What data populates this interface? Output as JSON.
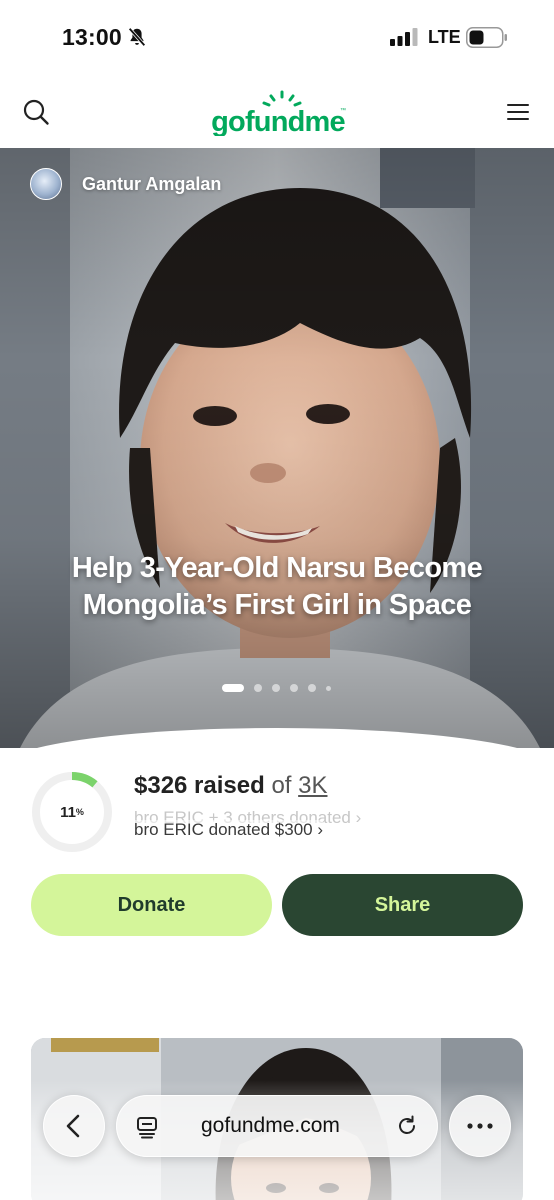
{
  "status_bar": {
    "time": "13:00",
    "network": "LTE",
    "icons": [
      "bell-slash-icon",
      "signal-icon",
      "battery-icon"
    ]
  },
  "header": {
    "logo_text": "gofundme",
    "logo_mark": "™",
    "icons": [
      "search-icon",
      "hamburger-menu-icon"
    ],
    "brand_color": "#02a95c"
  },
  "campaign": {
    "organizer": "Gantur Amgalan",
    "title": "Help 3-Year-Old Narsu Become Mongolia’s First Girl in Space",
    "carousel_slides": 6,
    "carousel_active": 0
  },
  "progress": {
    "percent_number": "11",
    "percent_sign": "%",
    "fraction": 0.11,
    "raised": "$326 raised",
    "of": "of",
    "goal": "3K",
    "donor_previous": "bro ERIC + 3 others donated",
    "donor_current": "bro ERIC donated $300"
  },
  "actions": {
    "donate_label": "Donate",
    "share_label": "Share",
    "donate_color": "#d4f59a",
    "share_color": "#2a4632"
  },
  "browser": {
    "url": "gofundme.com",
    "icons": [
      "chevron-left-icon",
      "tabs-icon",
      "reload-icon",
      "more-icon"
    ]
  }
}
